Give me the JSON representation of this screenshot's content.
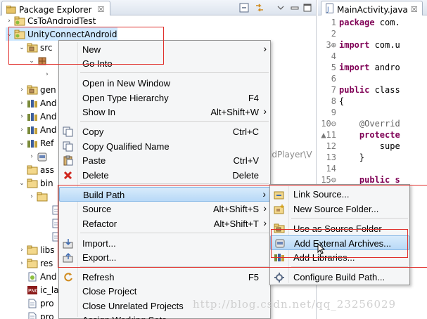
{
  "explorer": {
    "tab_label": "Package Explorer",
    "tab_close": "☒",
    "rows": [
      {
        "label": "CsToAndroidTest",
        "arrow": "›",
        "icon": "android-project-icon"
      },
      {
        "label": "UnityConnectAndroid",
        "arrow": "⌄",
        "icon": "android-project-icon"
      },
      {
        "label": "src",
        "arrow": "⌄",
        "icon": "source-folder-icon"
      },
      {
        "label": "",
        "arrow": "⌄",
        "icon": "package-icon"
      },
      {
        "label": "",
        "arrow": "›",
        "icon": ""
      },
      {
        "label": "gen",
        "arrow": "›",
        "icon": "source-folder-icon"
      },
      {
        "label": "And",
        "arrow": "›",
        "icon": "library-icon"
      },
      {
        "label": "And",
        "arrow": "›",
        "icon": "library-icon"
      },
      {
        "label": "And",
        "arrow": "›",
        "icon": "library-icon"
      },
      {
        "label": "Ref",
        "arrow": "⌄",
        "icon": "library-icon"
      },
      {
        "label": "",
        "arrow": "›",
        "icon": "jar-icon"
      },
      {
        "label": "ass",
        "arrow": "",
        "icon": "folder-icon"
      },
      {
        "label": "bin",
        "arrow": "⌄",
        "icon": "folder-icon"
      },
      {
        "label": "",
        "arrow": "›",
        "icon": "folder-icon"
      },
      {
        "label": "",
        "arrow": "",
        "icon": "file-icon"
      },
      {
        "label": "",
        "arrow": "",
        "icon": "file-icon"
      },
      {
        "label": "",
        "arrow": "",
        "icon": "file-icon"
      },
      {
        "label": "libs",
        "arrow": "›",
        "icon": "folder-icon"
      },
      {
        "label": "res",
        "arrow": "›",
        "icon": "folder-icon"
      },
      {
        "label": "And",
        "arrow": "",
        "icon": "android-file-icon"
      },
      {
        "label": "ic_la",
        "arrow": "",
        "icon": "png-file-icon"
      },
      {
        "label": "pro",
        "arrow": "",
        "icon": "file-icon"
      },
      {
        "label": "pro",
        "arrow": "",
        "icon": "file-icon"
      }
    ],
    "partial_text": "idPlayer\\V"
  },
  "editor": {
    "tab_label": "MainActivity.java",
    "tab_close": "☒",
    "lines": [
      {
        "num": "1",
        "kw": "package",
        "rest": " com."
      },
      {
        "num": "2",
        "kw": "",
        "rest": ""
      },
      {
        "num": "3⊕",
        "kw": "import",
        "rest": " com.u"
      },
      {
        "num": "4",
        "kw": "",
        "rest": ""
      },
      {
        "num": "5",
        "kw": "import",
        "rest": " andro"
      },
      {
        "num": "6",
        "kw": "",
        "rest": ""
      },
      {
        "num": "7",
        "kw": "public",
        "rest": " class"
      },
      {
        "num": "8",
        "kw": "",
        "rest": "{"
      },
      {
        "num": "9",
        "kw": "",
        "rest": ""
      },
      {
        "num": "10⊖",
        "kw": "",
        "rest": "    @Overrid"
      },
      {
        "num": "▲11",
        "kw": "",
        "rest": "    protecte"
      },
      {
        "num": "12",
        "kw": "",
        "rest": "        supe"
      },
      {
        "num": "13",
        "kw": "",
        "rest": "    }"
      },
      {
        "num": "14",
        "kw": "",
        "rest": ""
      },
      {
        "num": "15⊖",
        "kw": "",
        "rest": "    public s"
      }
    ]
  },
  "context_menu": {
    "items": [
      {
        "label": "New",
        "shortcut": "",
        "submenu": true,
        "icon": ""
      },
      {
        "label": "Go Into",
        "shortcut": "",
        "submenu": false,
        "icon": ""
      },
      {
        "label": "Open in New Window",
        "shortcut": "",
        "submenu": false,
        "icon": ""
      },
      {
        "label": "Open Type Hierarchy",
        "shortcut": "F4",
        "submenu": false,
        "icon": ""
      },
      {
        "label": "Show In",
        "shortcut": "Alt+Shift+W",
        "submenu": true,
        "icon": ""
      },
      {
        "label": "Copy",
        "shortcut": "Ctrl+C",
        "submenu": false,
        "icon": "copy-icon"
      },
      {
        "label": "Copy Qualified Name",
        "shortcut": "",
        "submenu": false,
        "icon": "copy-icon"
      },
      {
        "label": "Paste",
        "shortcut": "Ctrl+V",
        "submenu": false,
        "icon": "paste-icon"
      },
      {
        "label": "Delete",
        "shortcut": "Delete",
        "submenu": false,
        "icon": "delete-icon"
      },
      {
        "label": "Build Path",
        "shortcut": "",
        "submenu": true,
        "icon": ""
      },
      {
        "label": "Source",
        "shortcut": "Alt+Shift+S",
        "submenu": true,
        "icon": ""
      },
      {
        "label": "Refactor",
        "shortcut": "Alt+Shift+T",
        "submenu": true,
        "icon": ""
      },
      {
        "label": "Import...",
        "shortcut": "",
        "submenu": false,
        "icon": "import-icon"
      },
      {
        "label": "Export...",
        "shortcut": "",
        "submenu": false,
        "icon": "export-icon"
      },
      {
        "label": "Refresh",
        "shortcut": "F5",
        "submenu": false,
        "icon": "refresh-icon"
      },
      {
        "label": "Close Project",
        "shortcut": "",
        "submenu": false,
        "icon": ""
      },
      {
        "label": "Close Unrelated Projects",
        "shortcut": "",
        "submenu": false,
        "icon": ""
      },
      {
        "label": "Assign Working Sets...",
        "shortcut": "",
        "submenu": false,
        "icon": ""
      }
    ]
  },
  "build_path_menu": {
    "items": [
      {
        "label": "Link Source...",
        "icon": "link-source-icon"
      },
      {
        "label": "New Source Folder...",
        "icon": "new-source-folder-icon"
      },
      {
        "label": "Use as Source Folder",
        "icon": "source-folder-icon"
      },
      {
        "label": "Add External Archives...",
        "icon": "jar-icon"
      },
      {
        "label": "Add Libraries...",
        "icon": "library-icon"
      },
      {
        "label": "Configure Build Path...",
        "icon": "configure-icon"
      }
    ]
  },
  "watermark": "http://blog.csdn.net/qq_23256029",
  "colors": {
    "highlight": "#b8d9f7",
    "annotation_box": "#e0302c",
    "keyword": "#7f0055"
  }
}
